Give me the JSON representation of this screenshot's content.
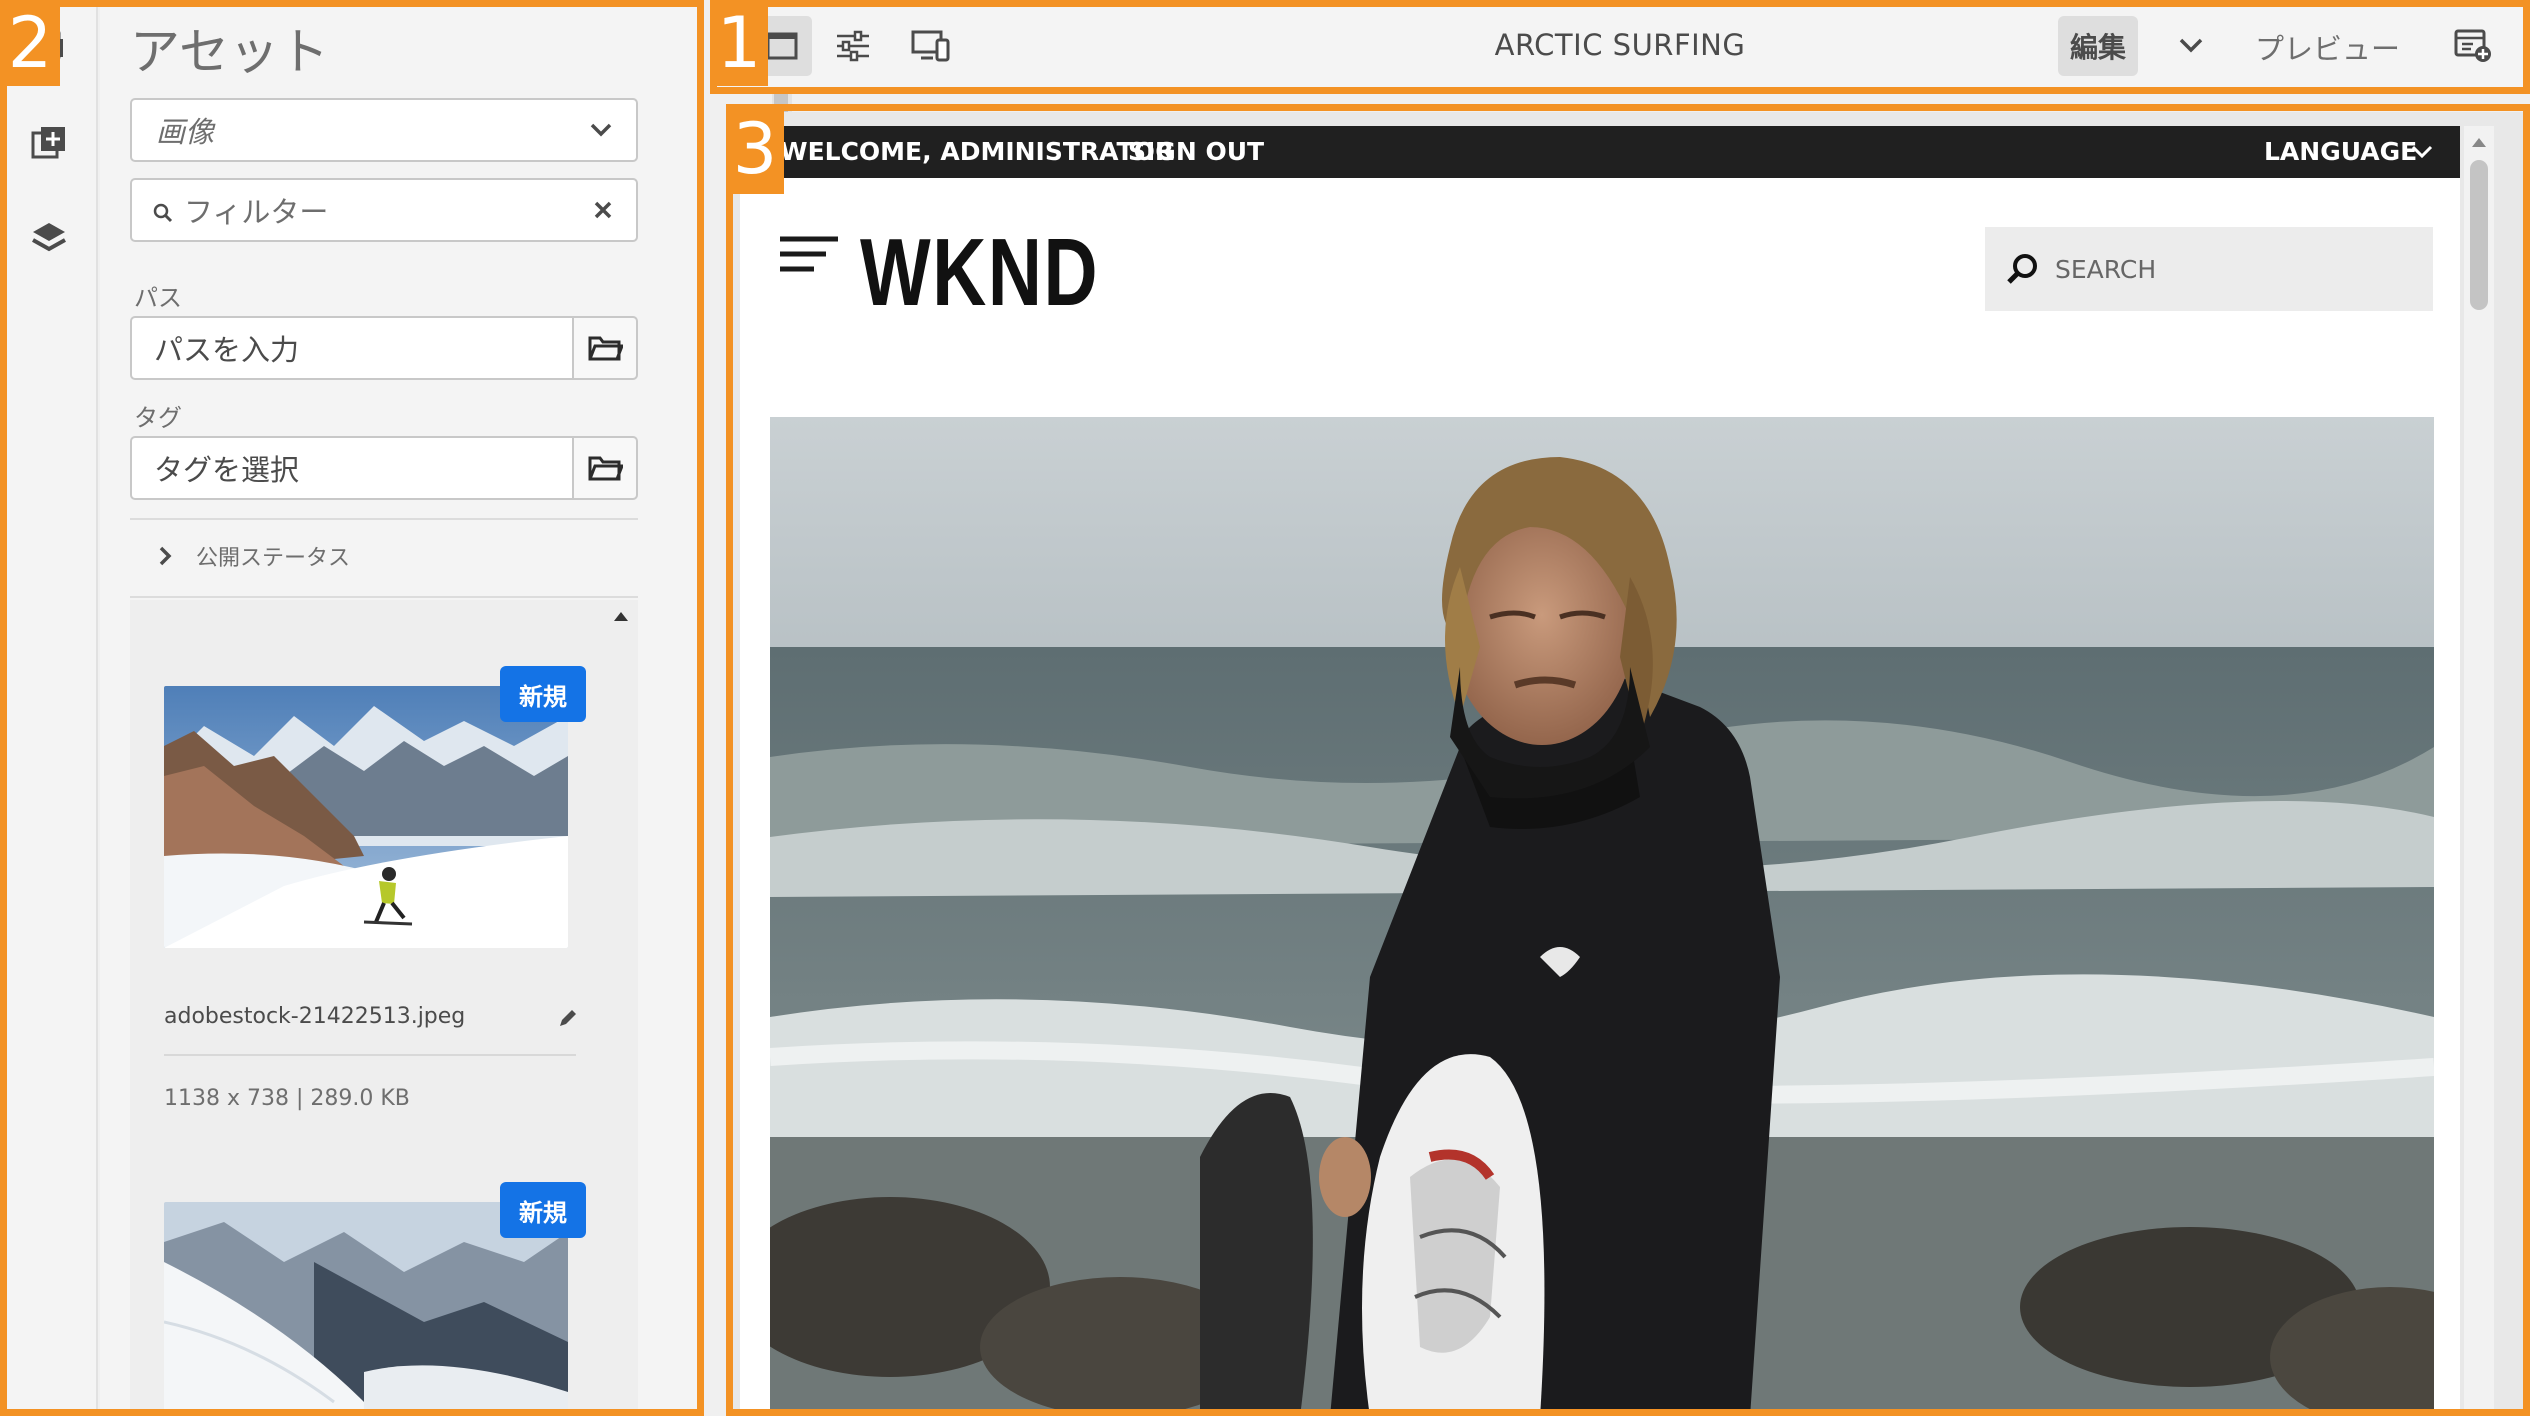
{
  "colors": {
    "callout": "#f39224",
    "badge": "#1473e6",
    "site_bar": "#202020"
  },
  "left_rail": {
    "icons": [
      "assets-icon",
      "components-icon",
      "layers-icon"
    ]
  },
  "asset_panel": {
    "title": "アセット",
    "type_select": "画像",
    "filter_placeholder": "フィルター",
    "path_label": "パス",
    "path_placeholder": "パスを入力",
    "tag_label": "タグ",
    "tag_placeholder": "タグを選択",
    "publish_status": "公開ステータス",
    "assets": [
      {
        "badge": "新規",
        "name": "adobestock-21422513.jpeg",
        "meta": "1138 x 738 | 289.0 KB"
      },
      {
        "badge": "新規"
      }
    ]
  },
  "toolbar": {
    "page_title": "ARCTIC SURFING",
    "mode": "編集",
    "preview": "プレビュー"
  },
  "site": {
    "welcome": "WELCOME, ADMINISTRATOR",
    "sign_out": "SIGN OUT",
    "language": "LANGUAGE",
    "logo": "WKND",
    "search_placeholder": "SEARCH"
  },
  "callouts": [
    "1",
    "2",
    "3"
  ]
}
